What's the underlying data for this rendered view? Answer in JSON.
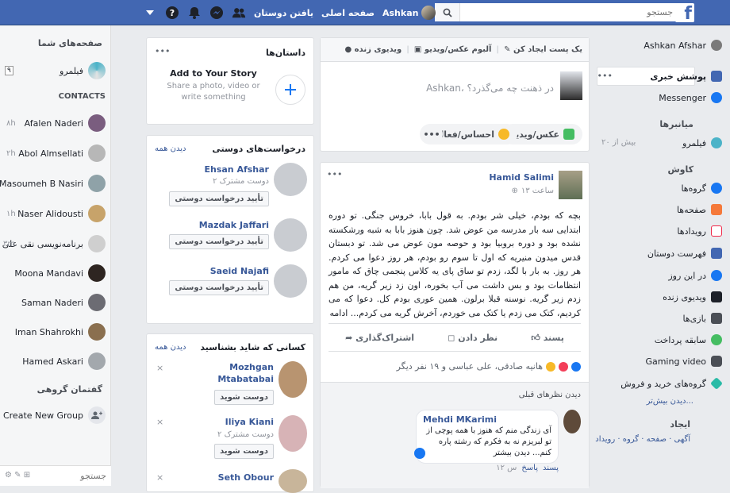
{
  "topbar": {
    "search_placeholder": "جستجو",
    "user_name": "Ashkan",
    "home_label": "صفحه اصلی",
    "find_friends_label": "یافتن دوستان"
  },
  "right_sidebar": {
    "profile_name": "Ashkan Afshar",
    "news_feed": "پوشش خبری",
    "more_dots": "•••",
    "messenger": "Messenger",
    "shortcuts_title": "میانبرها",
    "film_label": "فیلمرو",
    "film_badge": "بیش از ۲۰",
    "explore_title": "کاوش",
    "explore_items": [
      "گروه‌ها",
      "صفحه‌ها",
      "رویدادها",
      "فهرست دوستان",
      "در این روز",
      "ویدیوی زنده",
      "بازی‌ها",
      "سابقه پرداخت",
      "Gaming video",
      "گروه‌های خرید و فروش"
    ],
    "see_more": "دیدن بیش‌تر...",
    "create_title": "ایجاد",
    "create_links": "آگهی · صفحه · گروه · رویداد"
  },
  "left_chat": {
    "pages_title": "صفحه‌های شما",
    "page_name": "فیلمرو",
    "page_badge": "۹",
    "contacts_title": "CONTACTS",
    "contacts": [
      {
        "name": "Afalen Naderi",
        "time": "۸h"
      },
      {
        "name": "Abol Almsellati",
        "time": "۲h"
      },
      {
        "name": "Masoumeh B Nasiri",
        "time": ""
      },
      {
        "name": "Naser Alidousti",
        "time": "۱h"
      },
      {
        "name": "برنامه‌نویسی نقی علی",
        "time": "۳m"
      },
      {
        "name": "Moona Mandavi",
        "time": ""
      },
      {
        "name": "Saman Naderi",
        "time": ""
      },
      {
        "name": "Iman Shahrokhi",
        "time": ""
      },
      {
        "name": "Hamed Askari",
        "time": ""
      }
    ],
    "group_title": "گفتمان گروهی",
    "create_group": "Create New Group",
    "search_placeholder": "جستجو"
  },
  "stories": {
    "title": "داستان‌ها",
    "dots": "•••",
    "add_title": "Add to Your Story",
    "add_sub": "Share a photo, video or write something"
  },
  "friend_requests": {
    "title": "درخواست‌های دوستی",
    "see_all": "دیدن همه",
    "items": [
      {
        "name": "Ehsan Afshar",
        "mutual": "۲ دوست مشترک",
        "button": "تأیید درخواست دوستی"
      },
      {
        "name": "Mazdak Jaffari",
        "button": "تأیید درخواست دوستی"
      },
      {
        "name": "Saeid Najafi",
        "button": "تأیید درخواست دوستی"
      }
    ]
  },
  "pymk": {
    "title": "کسانی که شاید بشناسید",
    "see_all": "دیدن همه",
    "items": [
      {
        "name": "Mozhgan Mtabatabai",
        "button": "دوست شوید"
      },
      {
        "name": "Iliya Kiani",
        "mutual": "۲ دوست مشترک",
        "button": "دوست شوید"
      },
      {
        "name": "Seth Obour",
        "button": ""
      }
    ]
  },
  "composer": {
    "tab_create": "یک پست ایجاد کن",
    "tab_album": "آلبوم عکس/ویدیو",
    "tab_live": "ویدیوی زنده",
    "placeholder": "Ashkan، در ذهنت چه می‌گذرد؟",
    "photo_video": "عکس/ویدیو",
    "feeling": "احساس/فعالیت",
    "more": "•••"
  },
  "post": {
    "author": "Hamid Salimi",
    "time": "۱۳ ساعت",
    "body": "بچه که بودم، خیلی شر بودم. به قول بابا، خروس جنگی. تو دوره ابتدایی سه بار مدرسه من عوض شد. چون هنوز بابا به شبه ورشکسته نشده بود و دوره بروبیا بود و حوصه مون عوض می شد. تو دبستان قدس میدون منیریه که اول تا سوم رو بودم، هر روز دعوا می کردم. هر روز. به بار با لگد، زدم تو ساق پای یه کلاس پنجمی چاق که مامور انتظامات بود و بس داشت می آب بخوره، اون زد زیر گریه، من هم زدم زیر گریه. نوسنه قبلا برلون. همین عوری بودم کل. دعوا که می کردیم، کتک می زدم یا کتک می خوردم، آخرش گریه می کردم... ادامه",
    "like": "پسند",
    "comment": "نظر دادن",
    "share": "اشتراک‌گذاری",
    "reactions": "هانیه صادقی، علی عباسی و ۱۹ نفر دیگر",
    "view_comments": "دیدن نظرهای قبلی",
    "commenter": "Mehdi MKarimi",
    "comment_text": "آی زندگی منم که هنوز با همه پوچی از تو لبریزم نه به فکرم که رشته پاره کنم... دیدن بیشتر",
    "comment_like": "پسند",
    "comment_reply": "پاسخ",
    "comment_time": "۱۲ س"
  }
}
